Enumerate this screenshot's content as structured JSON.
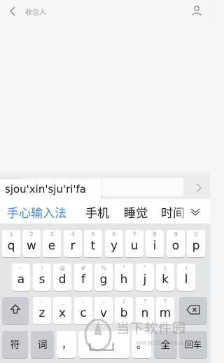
{
  "header": {
    "recipient_label": "收信人",
    "back_icon": "chevron-left-icon",
    "contact_icon": "person-icon"
  },
  "compose": {
    "pinyin": "sjou'xin'sju'ri'fa",
    "send_icon": "chevron-right-icon"
  },
  "candidates": {
    "items": [
      "手心输入法",
      "手机",
      "睡觉",
      "时间"
    ],
    "expand_icon": "chevron-down-icon"
  },
  "keyboard": {
    "row1": [
      {
        "key": "q",
        "hint": "1"
      },
      {
        "key": "w",
        "hint": "2"
      },
      {
        "key": "e",
        "hint": "3"
      },
      {
        "key": "r",
        "hint": "4"
      },
      {
        "key": "t",
        "hint": "5"
      },
      {
        "key": "y",
        "hint": "6"
      },
      {
        "key": "u",
        "hint": "7"
      },
      {
        "key": "i",
        "hint": "8"
      },
      {
        "key": "o",
        "hint": "9"
      },
      {
        "key": "p",
        "hint": "0"
      }
    ],
    "row2": [
      {
        "key": "a",
        "hint": "~"
      },
      {
        "key": "s",
        "hint": "!"
      },
      {
        "key": "d",
        "hint": "@"
      },
      {
        "key": "f",
        "hint": "#"
      },
      {
        "key": "g",
        "hint": "%"
      },
      {
        "key": "h",
        "hint": "\""
      },
      {
        "key": "j",
        "hint": "\""
      },
      {
        "key": "k",
        "hint": "("
      },
      {
        "key": "l",
        "hint": ")"
      }
    ],
    "row3": [
      {
        "key": "z",
        "hint": "-"
      },
      {
        "key": "x",
        "hint": "_"
      },
      {
        "key": "c",
        "hint": ":"
      },
      {
        "key": "v",
        "hint": ";"
      },
      {
        "key": "b",
        "hint": "/"
      },
      {
        "key": "n",
        "hint": "?"
      },
      {
        "key": "m",
        "hint": "?"
      }
    ],
    "shift_icon": "shift-icon",
    "delete_icon": "backspace-icon",
    "symbol_label": "符",
    "word_label": "词",
    "comma_label": "，",
    "period_label": "。",
    "lang_label": "全",
    "enter_label": "回车"
  },
  "watermark": {
    "text": "当下软件园",
    "url": "www.downxia.com"
  }
}
